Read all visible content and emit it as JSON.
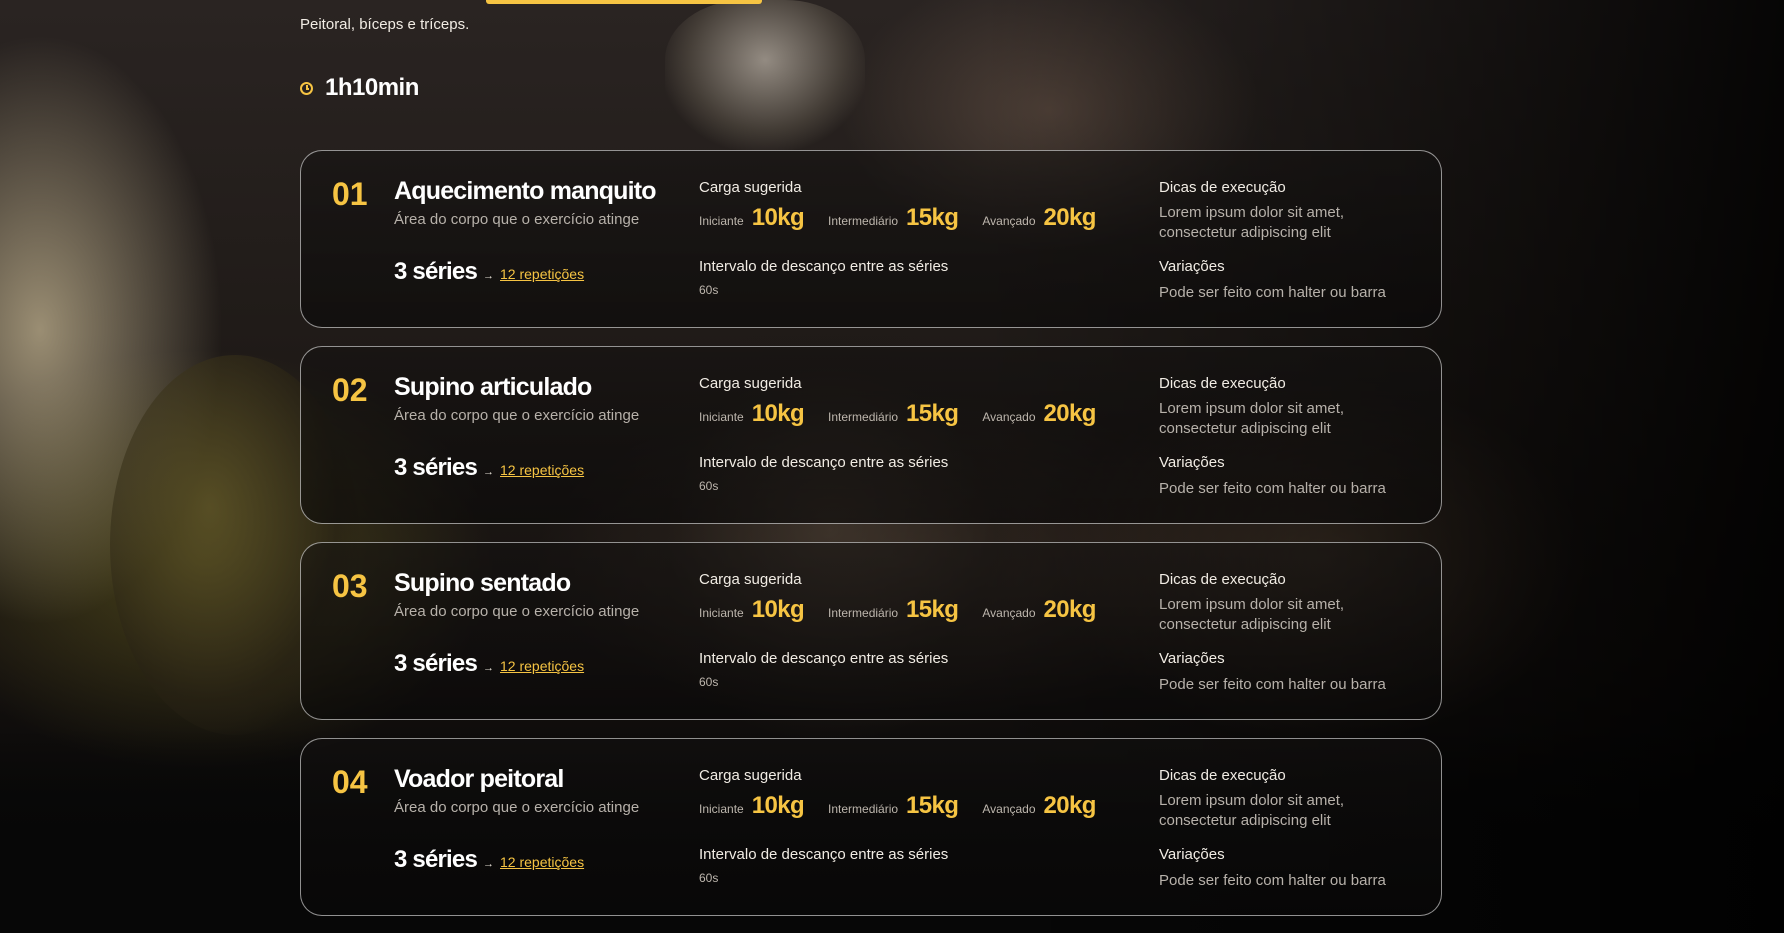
{
  "page": {
    "subtitle": "Peitoral, bíceps e tríceps.",
    "duration": "1h10min",
    "clock_icon": "clock-icon",
    "accent_color": "#f6c443"
  },
  "exercises": [
    {
      "number": "01",
      "name": "Aquecimento manquito",
      "area": "Área do corpo que o exercício atinge",
      "series": "3 séries",
      "arrow": "→",
      "reps": "12 repetições",
      "load_label": "Carga sugerida",
      "levels": [
        {
          "name": "Iniciante",
          "value": "10kg"
        },
        {
          "name": "Intermediário",
          "value": "15kg"
        },
        {
          "name": "Avançado",
          "value": "20kg"
        }
      ],
      "rest_label": "Intervalo de descanço entre as séries",
      "rest_value": "60s",
      "tips_label": "Dicas de execução",
      "tips_text": "Lorem ipsum dolor sit amet, consectetur adipiscing elit",
      "variations_label": "Variações",
      "variations_text": "Pode ser feito com halter ou barra"
    },
    {
      "number": "02",
      "name": "Supino articulado",
      "area": "Área do corpo que o exercício atinge",
      "series": "3 séries",
      "arrow": "→",
      "reps": "12 repetições",
      "load_label": "Carga sugerida",
      "levels": [
        {
          "name": "Iniciante",
          "value": "10kg"
        },
        {
          "name": "Intermediário",
          "value": "15kg"
        },
        {
          "name": "Avançado",
          "value": "20kg"
        }
      ],
      "rest_label": "Intervalo de descanço entre as séries",
      "rest_value": "60s",
      "tips_label": "Dicas de execução",
      "tips_text": "Lorem ipsum dolor sit amet, consectetur adipiscing elit",
      "variations_label": "Variações",
      "variations_text": "Pode ser feito com halter ou barra"
    },
    {
      "number": "03",
      "name": "Supino sentado",
      "area": "Área do corpo que o exercício atinge",
      "series": "3 séries",
      "arrow": "→",
      "reps": "12 repetições",
      "load_label": "Carga sugerida",
      "levels": [
        {
          "name": "Iniciante",
          "value": "10kg"
        },
        {
          "name": "Intermediário",
          "value": "15kg"
        },
        {
          "name": "Avançado",
          "value": "20kg"
        }
      ],
      "rest_label": "Intervalo de descanço entre as séries",
      "rest_value": "60s",
      "tips_label": "Dicas de execução",
      "tips_text": "Lorem ipsum dolor sit amet, consectetur adipiscing elit",
      "variations_label": "Variações",
      "variations_text": "Pode ser feito com halter ou barra"
    },
    {
      "number": "04",
      "name": "Voador peitoral",
      "area": "Área do corpo que o exercício atinge",
      "series": "3 séries",
      "arrow": "→",
      "reps": "12 repetições",
      "load_label": "Carga sugerida",
      "levels": [
        {
          "name": "Iniciante",
          "value": "10kg"
        },
        {
          "name": "Intermediário",
          "value": "15kg"
        },
        {
          "name": "Avançado",
          "value": "20kg"
        }
      ],
      "rest_label": "Intervalo de descanço entre as séries",
      "rest_value": "60s",
      "tips_label": "Dicas de execução",
      "tips_text": "Lorem ipsum dolor sit amet, consectetur adipiscing elit",
      "variations_label": "Variações",
      "variations_text": "Pode ser feito com halter ou barra"
    }
  ]
}
